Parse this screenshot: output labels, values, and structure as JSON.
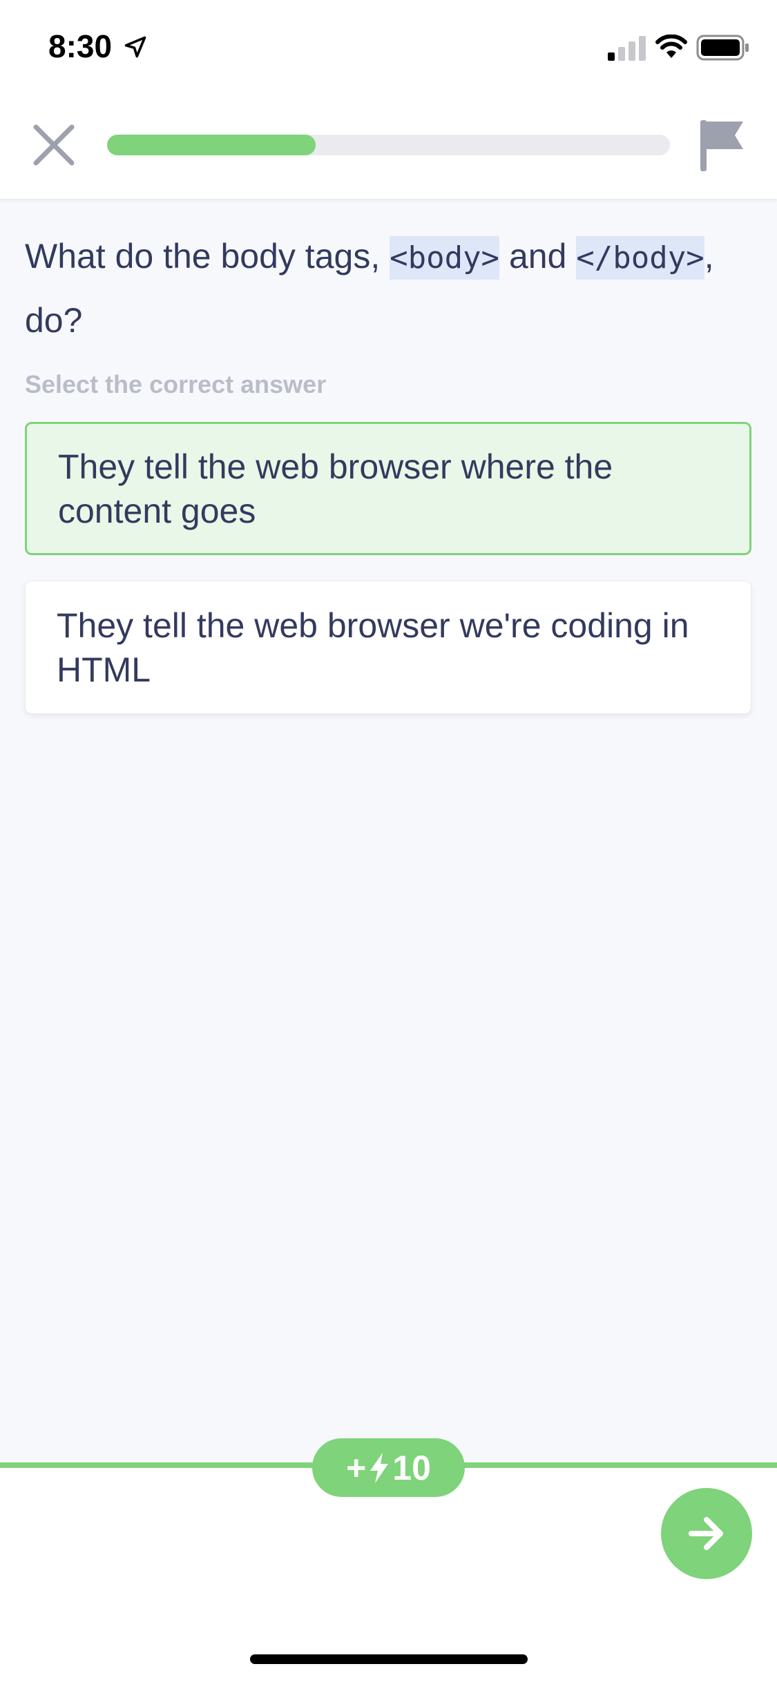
{
  "status_bar": {
    "time": "8:30",
    "icons": [
      "location-arrow-icon",
      "signal-icon",
      "wifi-icon",
      "battery-icon"
    ]
  },
  "header": {
    "close_icon": "close-icon",
    "flag_icon": "flag-icon",
    "progress_fraction": 0.37
  },
  "question": {
    "part1": "What do the body tags, ",
    "code1": "<body>",
    "part2": " and ",
    "code2": "</body>",
    "part3": ", do?"
  },
  "instruction": "Select the correct answer",
  "answers": [
    {
      "text": "They tell the web browser where the content goes",
      "selected": true
    },
    {
      "text": "They tell the web browser we're coding in HTML",
      "selected": false
    }
  ],
  "footer": {
    "xp_plus": "+",
    "xp_value": "10",
    "bolt_icon": "lightning-bolt-icon",
    "next_icon": "arrow-right-icon"
  },
  "colors": {
    "accent_green": "#7fd37a",
    "selected_bg": "#e8f7e7",
    "text_primary": "#333a5e",
    "code_highlight": "#dde7f8",
    "muted_text": "#b9bdc8"
  }
}
